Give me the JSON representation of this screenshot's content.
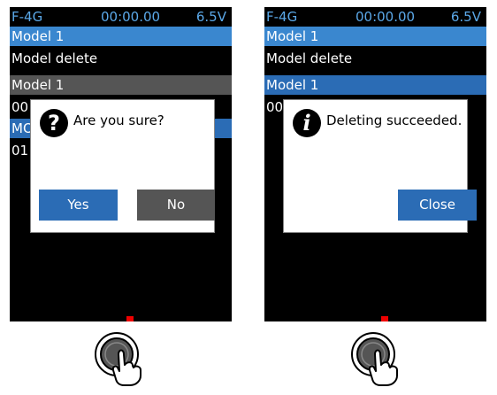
{
  "screens": [
    {
      "status": {
        "model_code": "F-4G",
        "timer": "00:00.00",
        "voltage": "6.5V"
      },
      "model_header": "Model 1",
      "title": "Model delete",
      "selected_model": "Model 1",
      "peek_rows": [
        "00",
        "MO",
        "01"
      ],
      "dialog": {
        "icon": "question-icon",
        "icon_glyph": "?",
        "message": "Are you sure?",
        "buttons": [
          "Yes",
          "No"
        ]
      }
    },
    {
      "status": {
        "model_code": "F-4G",
        "timer": "00:00.00",
        "voltage": "6.5V"
      },
      "model_header": "Model 1",
      "title": "Model delete",
      "selected_model": "Model 1",
      "peek_rows": [
        "00"
      ],
      "dialog": {
        "icon": "info-icon",
        "icon_glyph": "i",
        "message": "Deleting succeeded.",
        "buttons": [
          "Close"
        ]
      }
    }
  ],
  "colors": {
    "accent_blue": "#2b6cb5",
    "header_blue": "#3a87cf",
    "status_text": "#5ba8e8",
    "gray_button": "#555555"
  }
}
